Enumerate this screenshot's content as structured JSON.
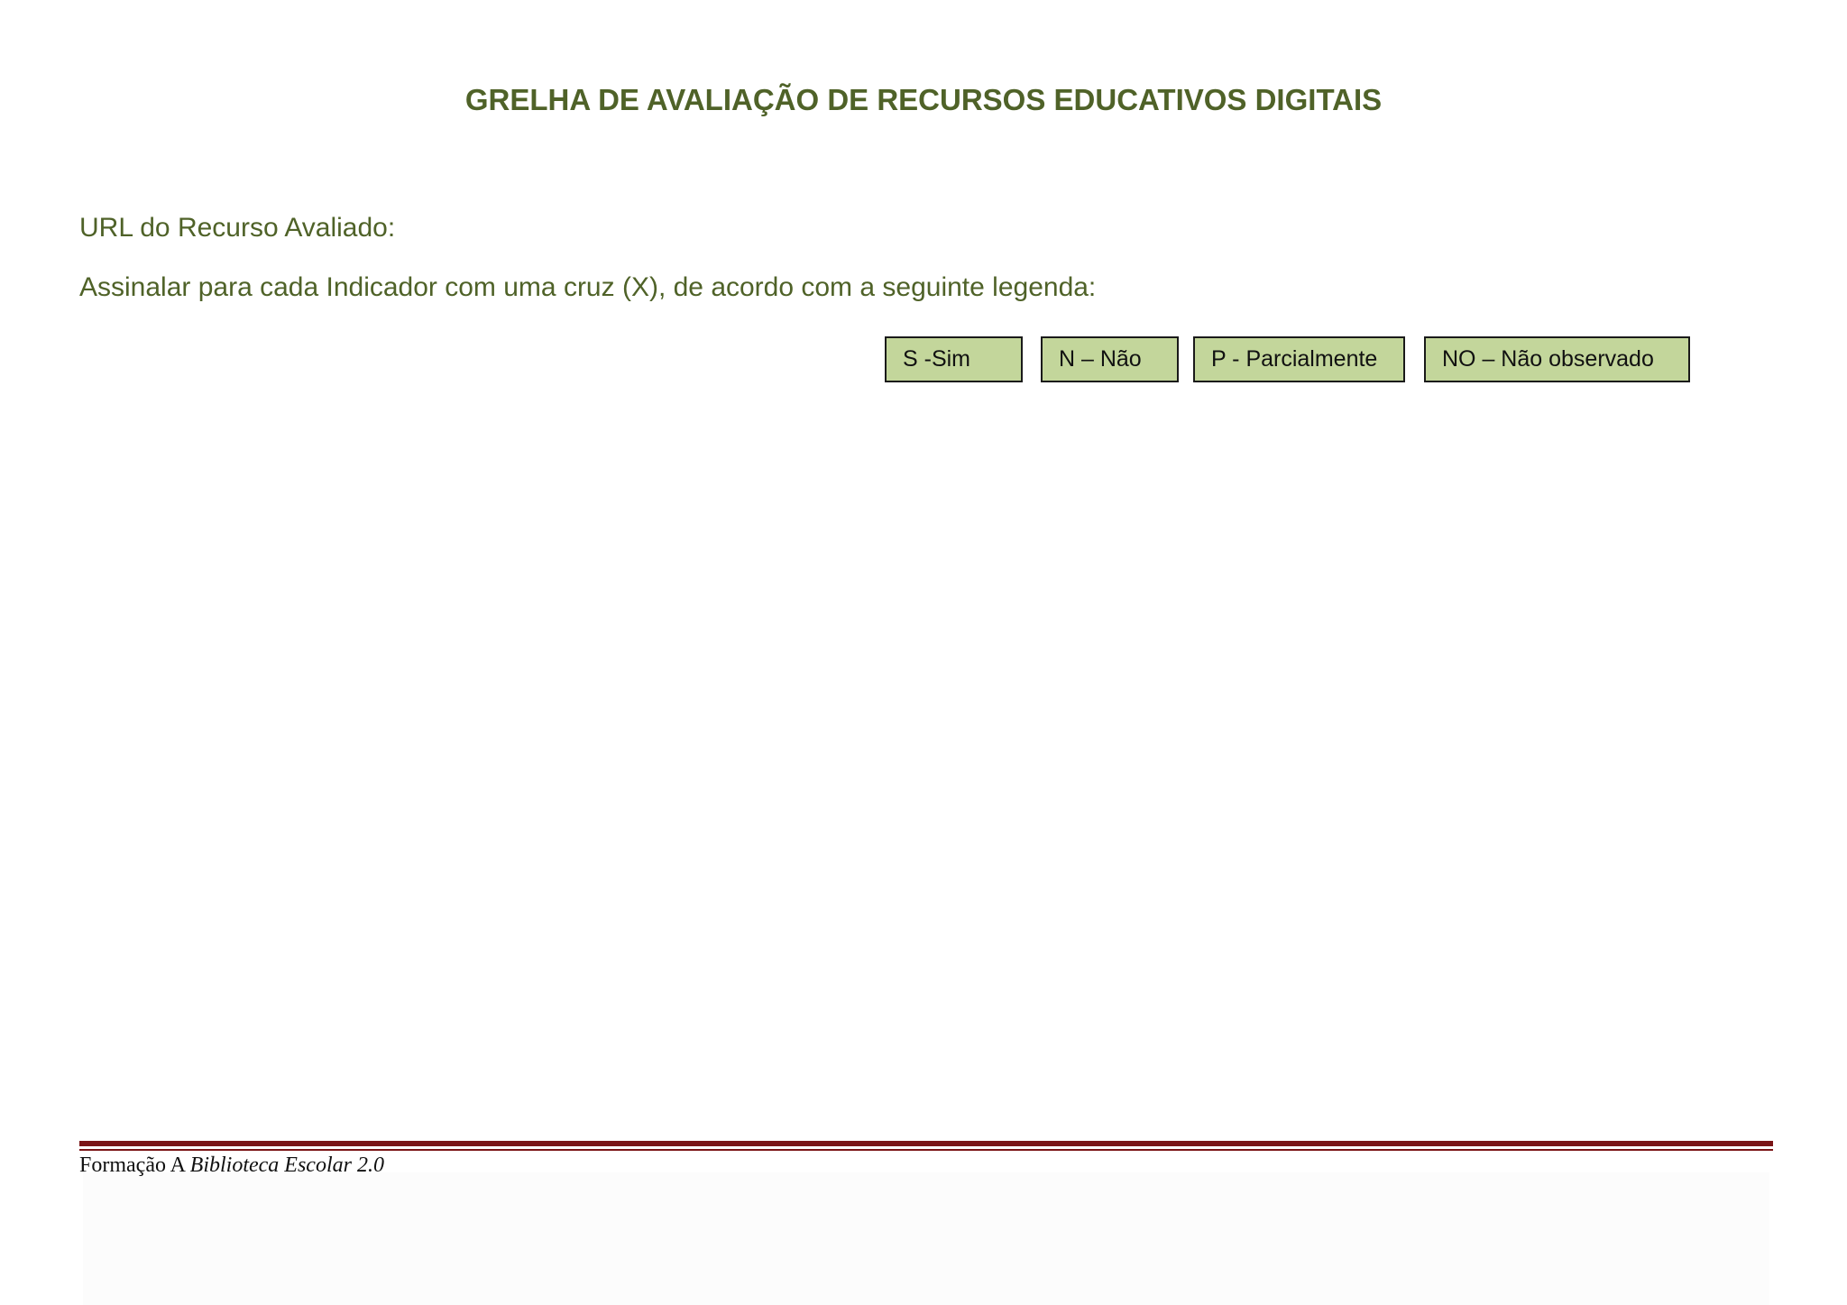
{
  "document": {
    "title": "GRELHA DE AVALIAÇÃO DE RECURSOS EDUCATIVOS DIGITAIS",
    "url_label": "URL do Recurso Avaliado:",
    "instructions": "Assinalar para cada Indicador com uma cruz (X), de acordo com a seguinte legenda:"
  },
  "legend": {
    "items": [
      {
        "label": "S -Sim"
      },
      {
        "label": "N – Não"
      },
      {
        "label": "P - Parcialmente"
      },
      {
        "label": "NO – Não observado"
      }
    ],
    "fill_color": "#c3d69b"
  },
  "footer": {
    "prefix": "Formação A ",
    "italic_part": "Biblioteca Escolar 2.0",
    "rule_color": "#7a1416"
  },
  "colors": {
    "heading": "#4f6228"
  }
}
